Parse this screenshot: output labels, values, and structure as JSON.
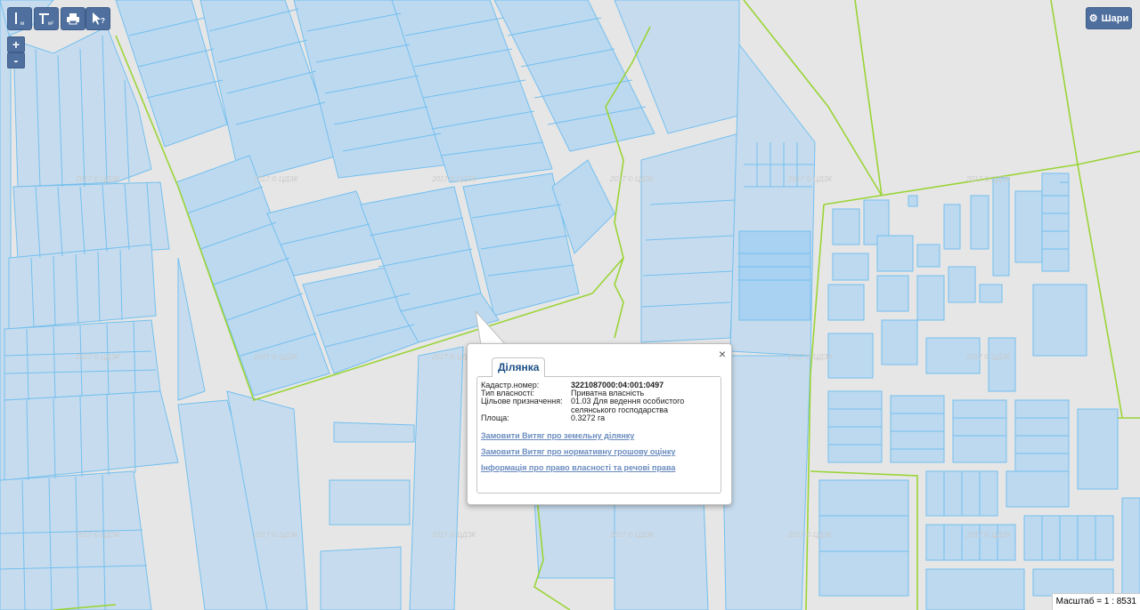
{
  "toolbar": {
    "tools": [
      {
        "name": "measure-length",
        "icon": "ruler-length-icon",
        "sub": "м"
      },
      {
        "name": "measure-area",
        "icon": "ruler-area-icon",
        "sub": "м²"
      },
      {
        "name": "print",
        "icon": "printer-icon"
      },
      {
        "name": "identify",
        "icon": "pointer-question-icon"
      }
    ]
  },
  "zoom": {
    "in_label": "+",
    "out_label": "-"
  },
  "layers": {
    "label": "Шари",
    "icon": "gear-icon"
  },
  "watermark": "2017 © ЦДЗК",
  "popup": {
    "tab_label": "Ділянка",
    "close_label": "×",
    "fields": [
      {
        "key": "Кадастр.номер:",
        "value": "3221087000:04:001:0497",
        "bold": true
      },
      {
        "key": "Тип власності:",
        "value": "Приватна власність"
      },
      {
        "key": "Цільове призначення:",
        "value": "01.03 Для ведення особистого селянського господарства"
      },
      {
        "key": "Площа:",
        "value": "0.3272 га"
      }
    ],
    "links": [
      "Замовити Витяг про земельну ділянку",
      "Замовити Витяг про нормативну грошову оцінку",
      "Інформація про право власності та речові права"
    ]
  },
  "scale": "Масштаб = 1 : 8531",
  "colors": {
    "parcel_fill": "#bcd9f0",
    "parcel_stroke": "#74bfee",
    "boundary": "#9ad436",
    "road": "#e6e6e6",
    "accent": "#4f6f9e"
  }
}
